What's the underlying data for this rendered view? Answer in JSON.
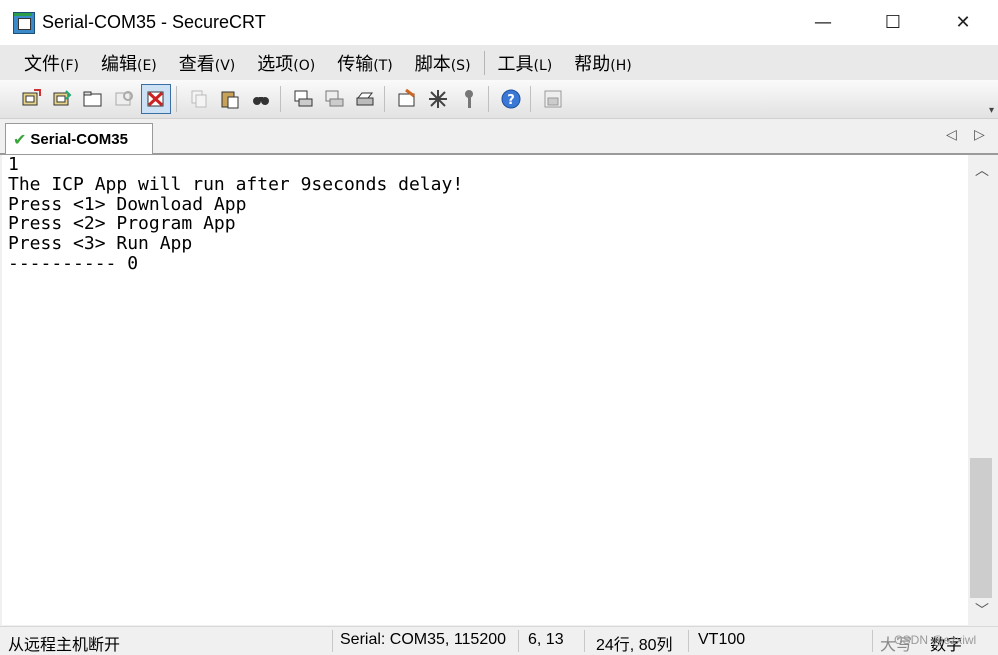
{
  "window": {
    "title": "Serial-COM35 - SecureCRT",
    "controls": {
      "minimize": "—",
      "maximize": "☐",
      "close": "✕"
    }
  },
  "menu": [
    {
      "label": "文件",
      "accel": "(F)"
    },
    {
      "label": "编辑",
      "accel": "(E)"
    },
    {
      "label": "查看",
      "accel": "(V)"
    },
    {
      "label": "选项",
      "accel": "(O)"
    },
    {
      "label": "传输",
      "accel": "(T)"
    },
    {
      "label": "脚本",
      "accel": "(S)"
    },
    {
      "label": "工具",
      "accel": "(L)"
    },
    {
      "label": "帮助",
      "accel": "(H)"
    }
  ],
  "toolbar": {
    "icons": [
      "connect-icon",
      "quick-connect-icon",
      "connect-in-tab-icon",
      "reconnect-icon",
      "disconnect-icon",
      "copy-icon",
      "paste-icon",
      "find-icon",
      "print-screen-icon",
      "print-selection-icon",
      "print-icon",
      "session-options-icon",
      "global-options-icon",
      "keymap-icon",
      "help-icon",
      "sftp-icon"
    ]
  },
  "tabs": [
    {
      "label": "Serial-COM35",
      "active": true,
      "connected": true
    }
  ],
  "tab_nav": {
    "prev": "◁",
    "next": "▷"
  },
  "terminal": {
    "lines": [
      "1",
      "The ICP App will run after 9seconds delay!",
      "Press <1> Download App",
      "Press <2> Program App",
      "Press <3> Run App",
      "---------- 0"
    ]
  },
  "scrollbar": {
    "up": "︿",
    "down": "﹀"
  },
  "status": {
    "message": "从远程主机断开",
    "connection": "Serial: COM35, 115200",
    "cursor": "6,  13",
    "size": "24行, 80列",
    "emulation": "VT100",
    "caps": "大写",
    "num": "数字"
  },
  "watermark": "CSDN @ezxiwl",
  "colors": {
    "check": "#3aa53a",
    "title_bg": "#ffffff",
    "menu_bg": "#e9e9e9",
    "terminal_bg": "#ffffff"
  }
}
